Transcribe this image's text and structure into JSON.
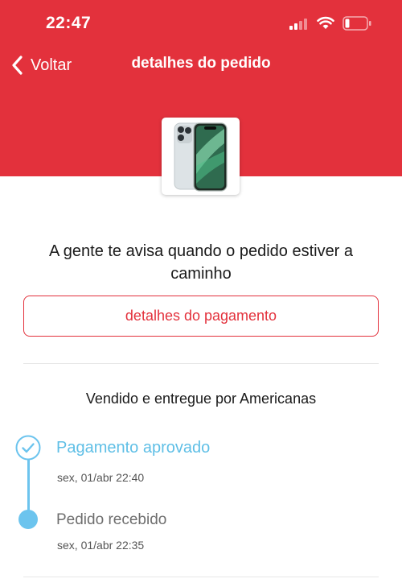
{
  "colors": {
    "brand_red": "#e3313c",
    "timeline_blue": "#6cc4ee"
  },
  "status_bar": {
    "time": "22:47",
    "icons": [
      "signal-icon",
      "wifi-icon",
      "battery-icon"
    ]
  },
  "nav": {
    "back_label": "Voltar",
    "back_icon": "chevron-left-icon",
    "title": "detalhes do pedido"
  },
  "product": {
    "image": "smartphone-image"
  },
  "message": "A gente te avisa quando o pedido estiver a caminho",
  "payment_button": "detalhes do pagamento",
  "seller": "Vendido e entregue por Americanas",
  "timeline": [
    {
      "title": "Pagamento aprovado",
      "date": "sex, 01/abr 22:40",
      "status": "done",
      "icon": "check-circle-icon"
    },
    {
      "title": "Pedido recebido",
      "date": "sex, 01/abr 22:35",
      "status": "received",
      "icon": "dot-icon"
    }
  ]
}
